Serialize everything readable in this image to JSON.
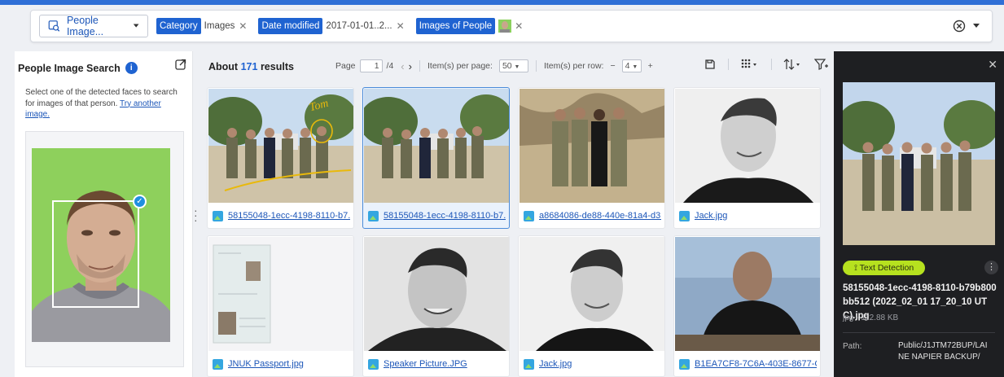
{
  "search": {
    "source_label": "People Image...",
    "filters": [
      {
        "key": "Category",
        "value": "Images"
      },
      {
        "key": "Date modified",
        "value": "2017-01-01..2..."
      },
      {
        "key": "Images of People",
        "value": ""
      }
    ]
  },
  "left_panel": {
    "title": "People Image Search",
    "info_glyph": "i",
    "description": "Select one of the detected faces to search for images of that person.",
    "link": "Try another image."
  },
  "results": {
    "prefix": "About",
    "count": "171",
    "suffix": "results"
  },
  "pager": {
    "page_label": "Page",
    "page_value": "1",
    "page_total": "/4",
    "per_page_label": "Item(s) per page:",
    "per_page_value": "50",
    "per_row_label": "Item(s) per row:",
    "per_row_value": "4",
    "minus": "−",
    "plus": "+"
  },
  "grid": {
    "items": [
      {
        "name": "58155048-1ecc-4198-8110-b7..."
      },
      {
        "name": "58155048-1ecc-4198-8110-b7..."
      },
      {
        "name": "a8684086-de88-440e-81a4-d3..."
      },
      {
        "name": "Jack.jpg"
      },
      {
        "name": "JNUK Passport.jpg"
      },
      {
        "name": "Speaker Picture.JPG"
      },
      {
        "name": "Jack.jpg"
      },
      {
        "name": "B1EA7CF8-7C6A-403E-8677-C..."
      }
    ]
  },
  "detail": {
    "badge": "Text Detection",
    "more_glyph": "⋮",
    "filename": "58155048-1ecc-4198-8110-b79b800bb512 (2022_02_01 17_20_10 UTC).jpg",
    "meta": "jpg - 112.88 KB",
    "path_label": "Path:",
    "path_value": "Public/J1JTM72BUP/LAINE NAPIER BACKUP/"
  },
  "colors": {
    "accent": "#1f63d1",
    "link": "#1c56b8",
    "badge": "#b6e11f",
    "dark_panel": "#1e1f22"
  }
}
